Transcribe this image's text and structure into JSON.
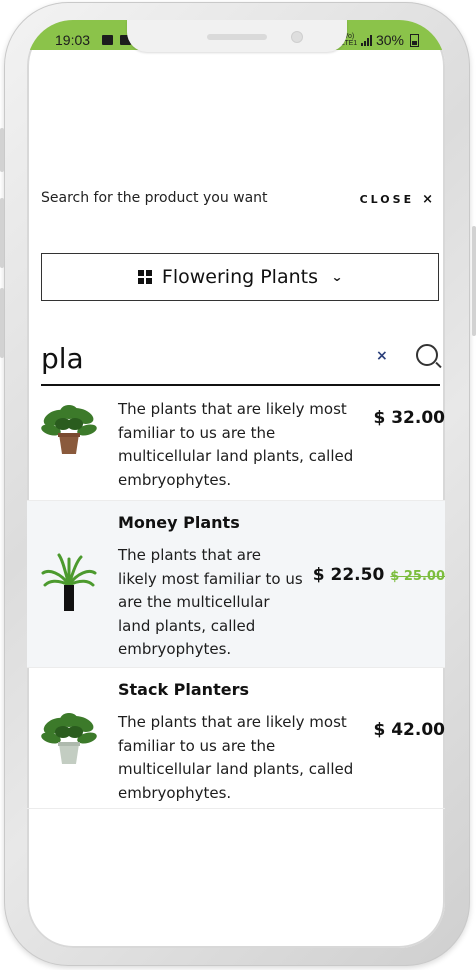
{
  "status_bar": {
    "time": "19:03",
    "network": "Vo) LTE1",
    "battery": "30%"
  },
  "header": {
    "title": "Search for the product you want",
    "close_label": "CLOSE",
    "close_icon": "close-icon"
  },
  "category": {
    "label": "Flowering Plants",
    "icon": "grid-icon"
  },
  "search": {
    "query": "pla",
    "clear_icon": "clear-icon",
    "search_icon": "search-icon"
  },
  "results": [
    {
      "name": "",
      "description": "The plants that are likely most familiar to us are the multicellular land plants, called embryophytes.",
      "price": "$ 32.00",
      "old_price": ""
    },
    {
      "name": "Money Plants",
      "description": "The plants that are likely most familiar to us are the multicellular land plants, called embryophytes.",
      "price": "$ 22.50",
      "old_price": "$ 25.00"
    },
    {
      "name": "Stack Planters",
      "description": "The plants that are likely most familiar to us are the multicellular land plants, called embryophytes.",
      "price": "$ 42.00",
      "old_price": ""
    }
  ],
  "colors": {
    "status_bar": "#8bc34a",
    "sale_price": "#7cbd3e",
    "alt_row": "#f4f6f8"
  }
}
